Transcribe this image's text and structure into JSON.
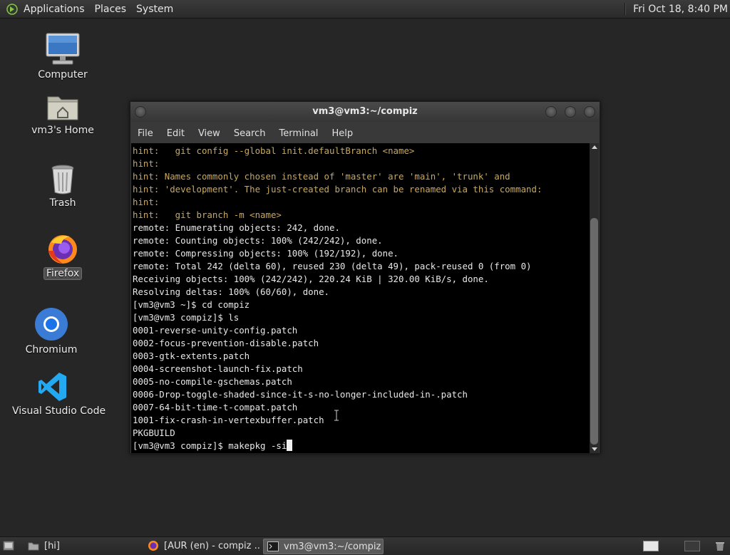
{
  "top_panel": {
    "menus": [
      "Applications",
      "Places",
      "System"
    ],
    "clock": "Fri Oct 18,  8:40 PM"
  },
  "desktop": {
    "icons": [
      {
        "label": "Computer",
        "icon": "computer-icon"
      },
      {
        "label": "vm3's Home",
        "icon": "home-folder-icon"
      },
      {
        "label": "Trash",
        "icon": "trash-icon"
      },
      {
        "label": "Firefox",
        "icon": "firefox-icon",
        "selected": true
      },
      {
        "label": "Chromium",
        "icon": "chromium-icon"
      },
      {
        "label": "Visual Studio Code",
        "icon": "vscode-icon"
      }
    ]
  },
  "terminal_window": {
    "title": "vm3@vm3:~/compiz",
    "menu": [
      "File",
      "Edit",
      "View",
      "Search",
      "Terminal",
      "Help"
    ],
    "lines": [
      {
        "text": "hint:   git config --global init.defaultBranch <name>",
        "style": "hint"
      },
      {
        "text": "hint:",
        "style": "hint"
      },
      {
        "text": "hint: Names commonly chosen instead of 'master' are 'main', 'trunk' and",
        "style": "hint"
      },
      {
        "text": "hint: 'development'. The just-created branch can be renamed via this command:",
        "style": "hint"
      },
      {
        "text": "hint:",
        "style": "hint"
      },
      {
        "text": "hint:   git branch -m <name>",
        "style": "hint"
      },
      {
        "text": "remote: Enumerating objects: 242, done.",
        "style": "normal"
      },
      {
        "text": "remote: Counting objects: 100% (242/242), done.",
        "style": "normal"
      },
      {
        "text": "remote: Compressing objects: 100% (192/192), done.",
        "style": "normal"
      },
      {
        "text": "remote: Total 242 (delta 60), reused 230 (delta 49), pack-reused 0 (from 0)",
        "style": "normal"
      },
      {
        "text": "Receiving objects: 100% (242/242), 220.24 KiB | 320.00 KiB/s, done.",
        "style": "normal"
      },
      {
        "text": "Resolving deltas: 100% (60/60), done.",
        "style": "normal"
      },
      {
        "text": "[vm3@vm3 ~]$ cd compiz",
        "style": "normal"
      },
      {
        "text": "[vm3@vm3 compiz]$ ls",
        "style": "normal"
      },
      {
        "text": "0001-reverse-unity-config.patch",
        "style": "normal"
      },
      {
        "text": "0002-focus-prevention-disable.patch",
        "style": "normal"
      },
      {
        "text": "0003-gtk-extents.patch",
        "style": "normal"
      },
      {
        "text": "0004-screenshot-launch-fix.patch",
        "style": "normal"
      },
      {
        "text": "0005-no-compile-gschemas.patch",
        "style": "normal"
      },
      {
        "text": "0006-Drop-toggle-shaded-since-it-s-no-longer-included-in-.patch",
        "style": "normal"
      },
      {
        "text": "0007-64-bit-time-t-compat.patch",
        "style": "normal"
      },
      {
        "text": "1001-fix-crash-in-vertexbuffer.patch",
        "style": "normal"
      },
      {
        "text": "PKGBUILD",
        "style": "normal"
      },
      {
        "text": "[vm3@vm3 compiz]$ makepkg -si",
        "style": "prompt"
      }
    ],
    "colors": {
      "hint": "#c9a85a",
      "text": "#e8e8e8",
      "background": "#000000"
    }
  },
  "taskbar": {
    "tasks": [
      {
        "label": "[hi]",
        "icon": "folder-icon",
        "active": false
      },
      {
        "label": "[AUR (en) - compiz ...",
        "icon": "firefox-icon",
        "active": false
      },
      {
        "label": "vm3@vm3:~/compiz",
        "icon": "terminal-icon",
        "active": true
      }
    ]
  }
}
